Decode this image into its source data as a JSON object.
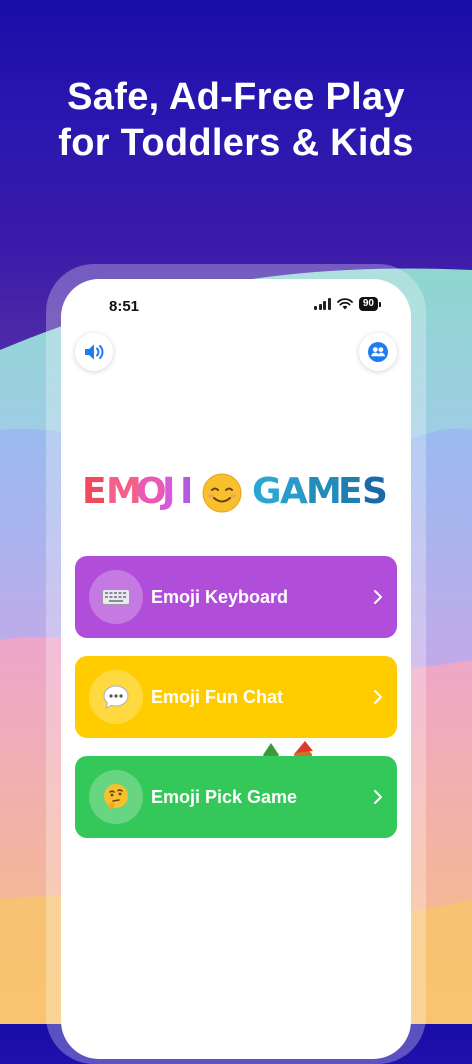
{
  "headline": {
    "line1": "Safe, Ad-Free Play",
    "line2": "for Toddlers & Kids"
  },
  "status_bar": {
    "time": "8:51",
    "battery": "90"
  },
  "top_buttons": {
    "left_icon": "speaker-icon",
    "right_icon": "people-icon"
  },
  "logo": {
    "word1": "EMOJI",
    "emoji": "😊",
    "word2": "GAMES",
    "colors": [
      "#f04a5c",
      "#f58a3c",
      "#f5c23c",
      "#4ac26b",
      "#3aa0e8",
      "#5b4fe0",
      "#e05aa8"
    ]
  },
  "menu": [
    {
      "label": "Emoji Keyboard",
      "emoji": "⌨️",
      "color": "#b04ed9",
      "icon": "keyboard-icon"
    },
    {
      "label": "Emoji Fun Chat",
      "emoji": "💬",
      "color": "#ffcc00",
      "icon": "speech-bubble-icon"
    },
    {
      "label": "Emoji Pick Game",
      "emoji": "🤔",
      "color": "#34c759",
      "icon": "thinking-face-icon"
    }
  ],
  "colors": {
    "background_top": "#1a0ea8",
    "accent_blue": "#1e7cf2"
  }
}
